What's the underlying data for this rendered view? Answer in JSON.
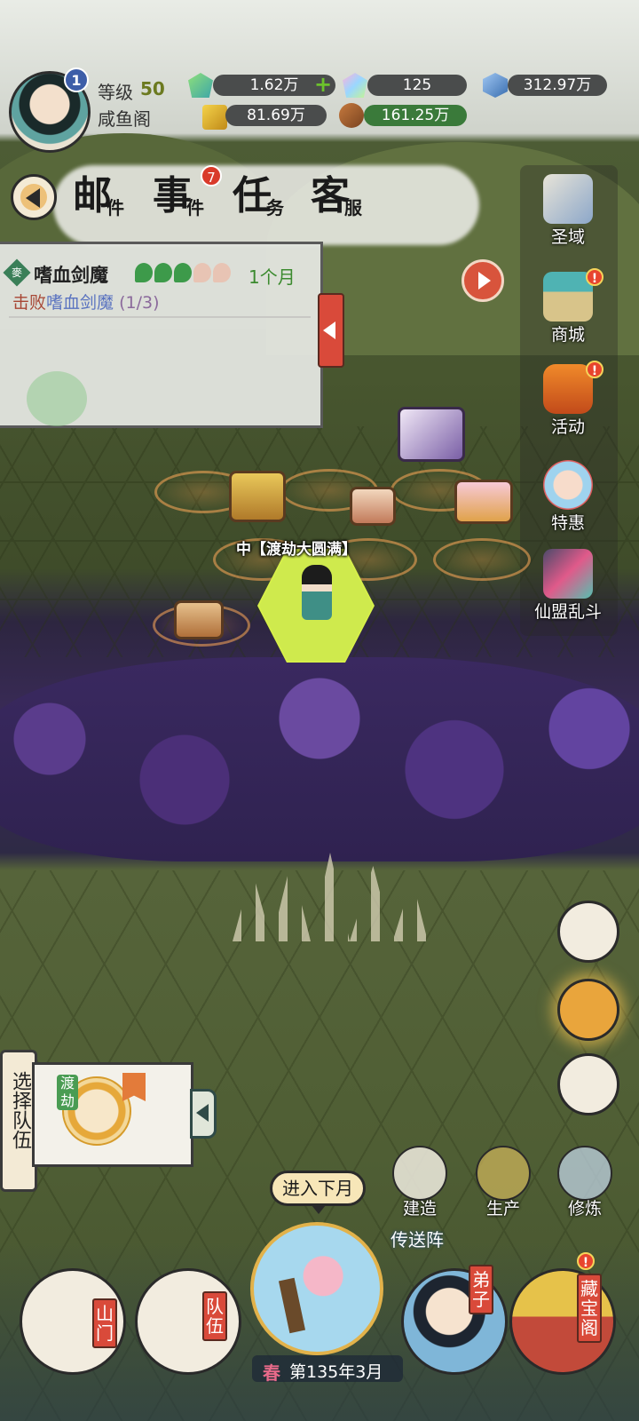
{
  "player": {
    "level_label": "等级",
    "level_value": "50",
    "sect_name": "咸鱼阁",
    "rank_badge": "1"
  },
  "resources": {
    "spirit_stone": "1.62万",
    "rainbow_stone": "125",
    "blue_crystal": "312.97万",
    "gold": "81.69万",
    "wood": "161.25万"
  },
  "tabs": {
    "mail": {
      "main": "邮",
      "sub": "件"
    },
    "events": {
      "main": "事",
      "sub": "件",
      "badge": "7"
    },
    "tasks": {
      "main": "任",
      "sub": "务"
    },
    "service": {
      "main": "客",
      "sub": "服"
    }
  },
  "quest": {
    "tag": "麥",
    "title": "嗜血剑魔",
    "time": "1个月",
    "desc_prefix": "击败",
    "desc_target": "嗜血剑魔",
    "desc_count": "(1/3)"
  },
  "right_menu": {
    "holy_domain": "圣域",
    "shop": "商城",
    "activity": "活动",
    "special_offer": "特惠",
    "alliance_battle": "仙盟乱斗"
  },
  "map": {
    "player_prefix": "中",
    "player_title": "【渡劫大圆满】"
  },
  "team": {
    "label": "选择队伍",
    "char_tag": "渡劫"
  },
  "actions": {
    "build": "建造",
    "produce": "生产",
    "cultivate": "修炼",
    "teleport": "传送阵",
    "enter_next_month": "进入下月"
  },
  "bottom_nav": {
    "mountain_gate": "山门",
    "team": "队伍",
    "disciples": "弟子",
    "treasure_pavilion": "藏宝阁",
    "season": "春",
    "date": "第135年3月"
  },
  "colors": {
    "accent_red": "#d94a3a",
    "level_green": "#6c7a20",
    "quest_time_green": "#3b8a2e",
    "swamp_purple": "#4b2f78"
  }
}
